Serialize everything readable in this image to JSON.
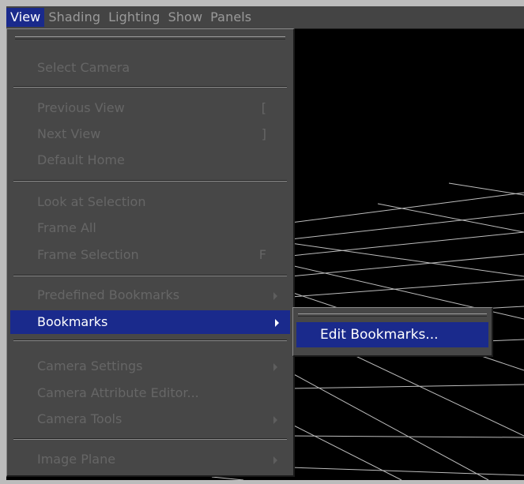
{
  "menubar": {
    "items": [
      {
        "label": "View"
      },
      {
        "label": "Shading"
      },
      {
        "label": "Lighting"
      },
      {
        "label": "Show"
      },
      {
        "label": "Panels"
      }
    ]
  },
  "view_menu": {
    "select_camera": "Select Camera",
    "previous_view": "Previous View",
    "previous_view_hotkey": "[",
    "next_view": "Next View",
    "next_view_hotkey": "]",
    "default_home": "Default Home",
    "look_at_selection": "Look at Selection",
    "frame_all": "Frame All",
    "frame_selection": "Frame Selection",
    "frame_selection_hotkey": "F",
    "predefined_bookmarks": "Predefined Bookmarks",
    "bookmarks": "Bookmarks",
    "camera_settings": "Camera Settings",
    "camera_attribute_editor": "Camera Attribute Editor...",
    "camera_tools": "Camera Tools",
    "image_plane": "Image Plane"
  },
  "bookmarks_submenu": {
    "edit_bookmarks": "Edit Bookmarks..."
  },
  "colors": {
    "highlight": "#1a2a8c",
    "menu_bg": "#474747",
    "disabled_text": "#666666",
    "viewport_bg": "#000000",
    "grid": "#bdbdbd"
  }
}
